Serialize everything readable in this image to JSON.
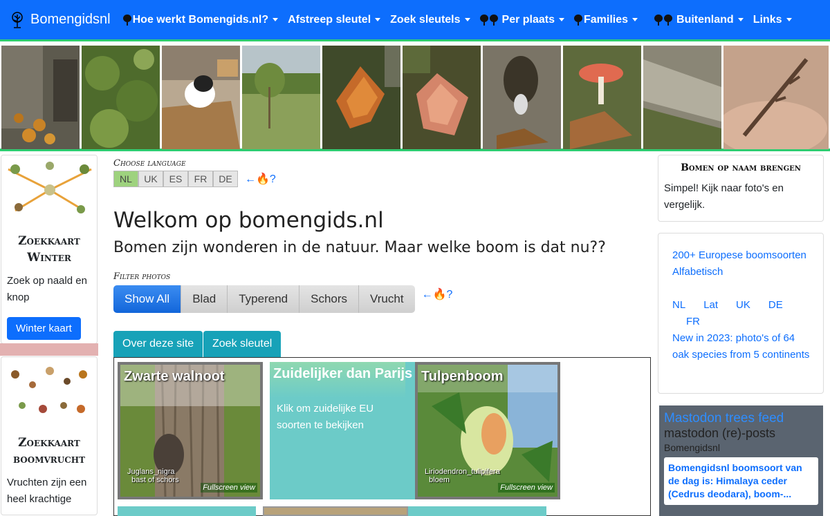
{
  "brand": {
    "name": "Bomengidsnl",
    "icon": "tree-logo-icon"
  },
  "nav": [
    {
      "label": "Hoe werkt Bomengids.nl?",
      "icon": "one-tree"
    },
    {
      "label": "Afstreep sleutel",
      "icon": ""
    },
    {
      "label": "Zoek sleutels",
      "icon": ""
    },
    {
      "label": "Per plaats",
      "icon": "two-trees"
    },
    {
      "label": "Families",
      "icon": "one-tree"
    },
    {
      "label": "Buitenland",
      "icon": "two-trees"
    },
    {
      "label": "Links",
      "icon": ""
    }
  ],
  "left": {
    "card1": {
      "title_line1": "Zoekkaart",
      "title_line2": "Winter",
      "text": "Zoek op naald en knop",
      "button": "Winter kaart"
    },
    "card2": {
      "title_line1": "Zoekkaart",
      "title_line2": "boomvrucht",
      "text": "Vruchten zijn een heel krachtige"
    }
  },
  "main": {
    "choose_language": "Choose language",
    "languages": [
      "NL",
      "UK",
      "ES",
      "FR",
      "DE"
    ],
    "active_language": "NL",
    "help_text": "←🔥?",
    "title": "Welkom op bomengids.nl",
    "subtitle": "Bomen zijn wonderen in de natuur. Maar welke boom is dat nu??",
    "filter_label": "Filter photos",
    "filters": [
      "Show All",
      "Blad",
      "Typerend",
      "Schors",
      "Vrucht"
    ],
    "active_filter": "Show All",
    "tabs": [
      "Over deze site",
      "Zoek sleutel"
    ],
    "tiles": [
      {
        "title": "Zwarte walnoot",
        "caption_line1": "Juglans_nigra",
        "caption_line2": "bast of schors",
        "fullscreen": "Fullscreen view"
      },
      {
        "title": "Zuidelijker dan Parijs",
        "text": "Klik om zuidelijke EU soorten te bekijken"
      },
      {
        "title": "Tulpenboom",
        "caption_line1": "Liriodendron_tulipifera",
        "caption_line2": "bloem",
        "fullscreen": "Fullscreen view"
      }
    ]
  },
  "right": {
    "card1": {
      "title": "Bomen op naam brengen",
      "text": "Simpel! Kijk naar foto's en vergelijk."
    },
    "card2": {
      "link1": "200+ Europese boomsoorten Alfabetisch",
      "langs": [
        "NL",
        "Lat",
        "UK",
        "DE",
        "FR"
      ],
      "link2": "New in 2023: photo's of 64 oak species from 5 continents"
    },
    "mastodon": {
      "title": "Mastodon trees feed",
      "subtitle": "mastodon (re)-posts",
      "user": "Bomengidsnl",
      "post": "Bomengidsnl boomsoort van de dag is: Himalaya ceder (Cedrus deodara), boom-..."
    }
  },
  "colors": {
    "navbar": "#0d6efd",
    "accent_green": "#2ecc71",
    "teal": "#17a2b8",
    "teal_tile": "#6ccbc8"
  }
}
